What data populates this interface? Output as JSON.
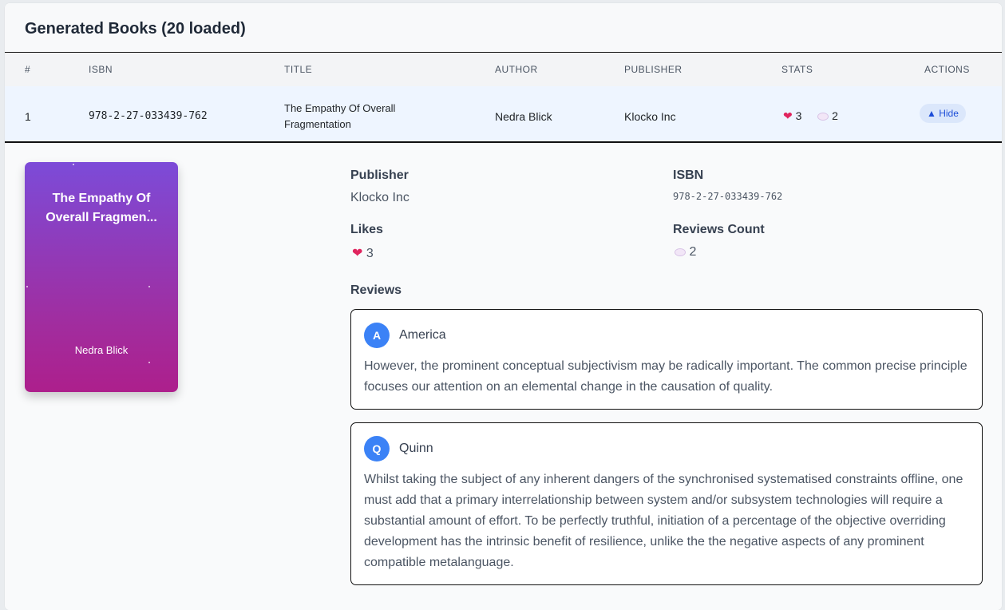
{
  "header": {
    "title": "Generated Books (20 loaded)"
  },
  "table": {
    "columns": [
      "#",
      "ISBN",
      "TITLE",
      "AUTHOR",
      "PUBLISHER",
      "STATS",
      "ACTIONS"
    ],
    "rows": [
      {
        "index": "1",
        "isbn": "978-2-27-033439-762",
        "title": "The Empathy Of Overall Fragmentation",
        "author": "Nedra Blick",
        "publisher": "Klocko Inc",
        "likes": "3",
        "reviews": "2",
        "action": "▲ Hide"
      }
    ]
  },
  "detail": {
    "cover": {
      "title": "The Empathy Of Overall Fragmen...",
      "author": "Nedra Blick"
    },
    "publisher_label": "Publisher",
    "publisher": "Klocko Inc",
    "isbn_label": "ISBN",
    "isbn": "978-2-27-033439-762",
    "likes_label": "Likes",
    "likes": "3",
    "reviews_count_label": "Reviews Count",
    "reviews_count": "2",
    "reviews_label": "Reviews",
    "reviews": [
      {
        "initial": "A",
        "name": "America",
        "text": "However, the prominent conceptual subjectivism may be radically important. The common precise principle focuses our attention on an elemental change in the causation of quality."
      },
      {
        "initial": "Q",
        "name": "Quinn",
        "text": "Whilst taking the subject of any inherent dangers of the synchronised systematised constraints offline, one must add that a primary interrelationship between system and/or subsystem technologies will require a substantial amount of effort. To be perfectly truthful, initiation of a percentage of the objective overriding development has the intrinsic benefit of resilience, unlike the the negative aspects of any prominent compatible metalanguage."
      }
    ]
  },
  "icons": {
    "like": "heart-icon",
    "comment": "speech-bubble-icon"
  },
  "colors": {
    "accent": "#3b82f6",
    "row_highlight": "#eef5ff",
    "heart": "#e0245e"
  }
}
